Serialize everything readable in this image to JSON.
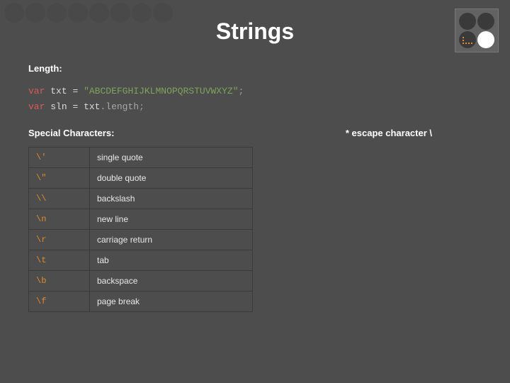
{
  "title": "Strings",
  "length_label": "Length:",
  "code": {
    "line1": {
      "var": "var",
      "sp1": " ",
      "id": "txt",
      "sp2": " ",
      "eq": "=",
      "sp3": " ",
      "str": "\"ABCDEFGHIJKLMNOPQRSTUVWXYZ\"",
      "semi": ";"
    },
    "line2": {
      "var": "var",
      "sp1": " ",
      "id": "sln",
      "sp2": " ",
      "eq": "=",
      "sp3": " ",
      "obj": "txt",
      "dot": ".",
      "mem": "length",
      "semi": ";"
    }
  },
  "special_label": "Special Characters:",
  "escape_note": "* escape character \\",
  "table": [
    {
      "seq": "\\'",
      "desc": "single quote"
    },
    {
      "seq": "\\\"",
      "desc": "double quote"
    },
    {
      "seq": "\\\\",
      "desc": "backslash"
    },
    {
      "seq": "\\n",
      "desc": "new line"
    },
    {
      "seq": "\\r",
      "desc": "carriage return"
    },
    {
      "seq": "\\t",
      "desc": "tab"
    },
    {
      "seq": "\\b",
      "desc": "backspace"
    },
    {
      "seq": "\\f",
      "desc": "page break"
    }
  ]
}
